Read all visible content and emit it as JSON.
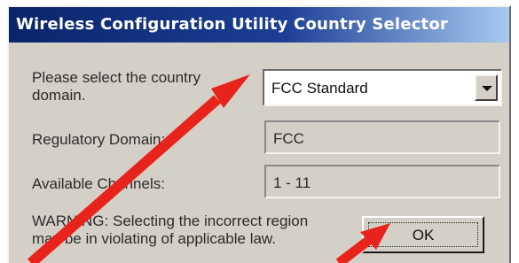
{
  "window": {
    "title": "Wireless Configuration Utility Country Selector"
  },
  "form": {
    "country_label": "Please select the country domain.",
    "country_value": "FCC Standard",
    "regulatory_label": "Regulatory Domain:",
    "regulatory_value": "FCC",
    "channels_label": "Available Channels:",
    "channels_value": "1 - 11",
    "warning_text": "WARNING: Selecting the incorrect region may be in violating of applicable law."
  },
  "buttons": {
    "ok_label": "OK"
  },
  "annotations": {
    "arrow_color": "#e8231b"
  },
  "icons": {
    "dropdown": "chevron-down-icon"
  }
}
